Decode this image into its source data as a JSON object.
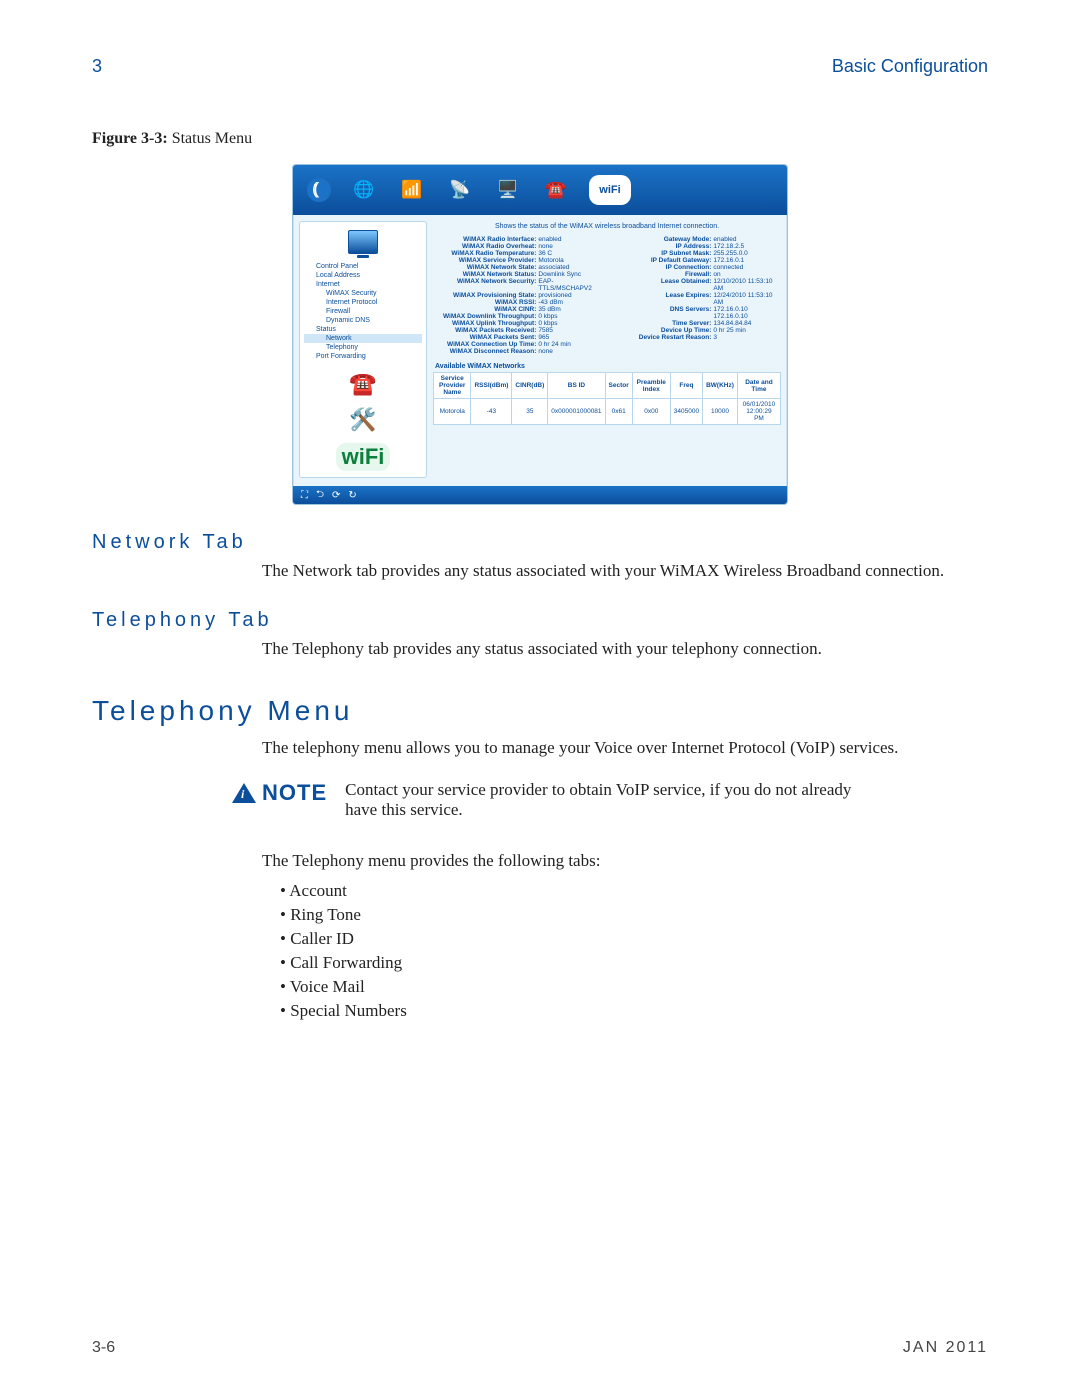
{
  "header": {
    "page_num": "3",
    "section": "Basic Configuration"
  },
  "figure_caption": {
    "label": "Figure 3-3:",
    "title": "Status Menu"
  },
  "screenshot": {
    "intro": "Shows the status of the WiMAX wireless broadband Internet connection.",
    "sidebar": {
      "items": [
        {
          "label": "Control Panel",
          "lv": 1
        },
        {
          "label": "Local Address",
          "lv": 1
        },
        {
          "label": "Internet",
          "lv": 1
        },
        {
          "label": "WiMAX Security",
          "lv": 2
        },
        {
          "label": "Internet Protocol",
          "lv": 2
        },
        {
          "label": "Firewall",
          "lv": 2
        },
        {
          "label": "Dynamic DNS",
          "lv": 2
        },
        {
          "label": "Status",
          "lv": 1
        },
        {
          "label": "Network",
          "lv": 2,
          "selected": true
        },
        {
          "label": "Telephony",
          "lv": 2
        },
        {
          "label": "Port Forwarding",
          "lv": 1
        }
      ]
    },
    "left_status": [
      {
        "k": "WiMAX Radio Interface:",
        "v": "enabled"
      },
      {
        "k": "WiMAX Radio Overheat:",
        "v": "none"
      },
      {
        "k": "WiMAX Radio Temperature:",
        "v": "36 C"
      },
      {
        "k": "WiMAX Service Provider:",
        "v": "Motorola"
      },
      {
        "k": "WiMAX Network State:",
        "v": "associated"
      },
      {
        "k": "WiMAX Network Status:",
        "v": "Downlink Sync"
      },
      {
        "k": "WiMAX Network Security:",
        "v": "EAP-TTLS/MSCHAPV2"
      },
      {
        "k": "WiMAX Provisioning State:",
        "v": "provisioned"
      },
      {
        "k": "WiMAX RSSI:",
        "v": "-43 dBm"
      },
      {
        "k": "WiMAX CINR:",
        "v": "35 dBm"
      },
      {
        "k": "WiMAX Downlink Throughput:",
        "v": "0 kbps"
      },
      {
        "k": "WiMAX Uplink Throughput:",
        "v": "0 kbps"
      },
      {
        "k": "WiMAX Packets Received:",
        "v": "7585"
      },
      {
        "k": "WiMAX Packets Sent:",
        "v": "965"
      },
      {
        "k": "WiMAX Connection Up Time:",
        "v": "0 hr 24 min"
      },
      {
        "k": "WiMAX Disconnect Reason:",
        "v": "none"
      }
    ],
    "right_status": [
      {
        "k": "Gateway Mode:",
        "v": "enabled"
      },
      {
        "k": "IP Address:",
        "v": "172.18.2.5"
      },
      {
        "k": "IP Subnet Mask:",
        "v": "255.255.0.0"
      },
      {
        "k": "IP Default Gateway:",
        "v": "172.16.0.1"
      },
      {
        "k": "IP Connection:",
        "v": "connected"
      },
      {
        "k": "Firewall:",
        "v": "on"
      },
      {
        "k": "Lease Obtained:",
        "v": "12/10/2010 11:53:10 AM"
      },
      {
        "k": "Lease Expires:",
        "v": "12/24/2010 11:53:10 AM"
      },
      {
        "k": "DNS Servers:",
        "v": "172.16.0.10 172.16.0.10"
      },
      {
        "k": "Time Server:",
        "v": "134.84.84.84"
      },
      {
        "k": "Device Up Time:",
        "v": "0 hr 25 min"
      },
      {
        "k": "Device Restart Reason:",
        "v": "3"
      }
    ],
    "available_label": "Available WiMAX Networks",
    "table": {
      "headers": [
        "Service Provider Name",
        "RSSI(dBm)",
        "CINR(dB)",
        "BS ID",
        "Sector",
        "Preamble Index",
        "Freq",
        "BW(KHz)",
        "Date and Time"
      ],
      "row": [
        "Motorola",
        "-43",
        "35",
        "0x000001000081",
        "0x61",
        "0x00",
        "3405000",
        "10000",
        "06/01/2010 12:00:29 PM"
      ]
    }
  },
  "sections": {
    "network_tab": {
      "title": "Network Tab",
      "body": "The Network tab provides any status associated with your WiMAX Wireless Broadband connection."
    },
    "telephony_tab": {
      "title": "Telephony Tab",
      "body": "The Telephony tab provides any status associated with your telephony connection."
    },
    "telephony_menu": {
      "title": "Telephony Menu",
      "intro": "The telephony menu allows you to manage your Voice over Internet Protocol (VoIP) services.",
      "note_label": "NOTE",
      "note_body": "Contact your service provider to obtain VoIP service, if you do not already have this service.",
      "tabs_intro": "The Telephony menu provides the following tabs:",
      "tabs": [
        "Account",
        "Ring Tone",
        "Caller ID",
        "Call Forwarding",
        "Voice Mail",
        "Special Numbers"
      ]
    }
  },
  "footer": {
    "left": "3-6",
    "right": "JAN 2011"
  }
}
